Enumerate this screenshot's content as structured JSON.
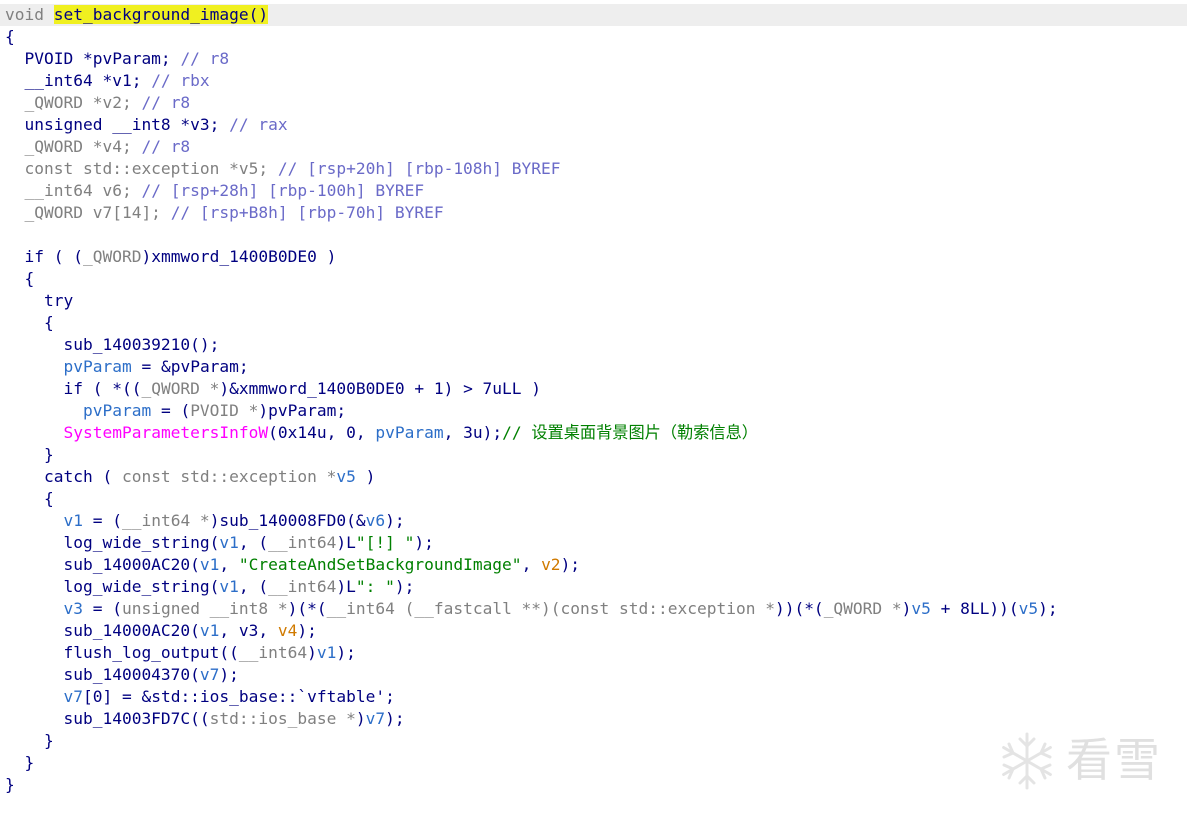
{
  "editor": {
    "theme": {
      "background": "#ffffff",
      "current_line": "#eeeeee",
      "highlight": "#f0f020",
      "keyword": "#000080",
      "local_var": "#2c6ec8",
      "comment": "#6a6ac8",
      "string": "#008000",
      "import_func": "#ff00ff",
      "gray_type": "#808080",
      "arg_var": "#d07a00"
    },
    "lines": [
      {
        "current": true,
        "tokens": [
          {
            "t": "void ",
            "c": "gray"
          },
          {
            "t": "set_background_image()",
            "c": "hl"
          }
        ]
      },
      {
        "tokens": [
          {
            "t": "{",
            "c": "kw"
          }
        ]
      },
      {
        "tokens": [
          {
            "t": "  PVOID *pvParam; ",
            "c": "kw"
          },
          {
            "t": "// r8",
            "c": "cm"
          }
        ]
      },
      {
        "tokens": [
          {
            "t": "  __int64 *v1; ",
            "c": "kw"
          },
          {
            "t": "// rbx",
            "c": "cm"
          }
        ]
      },
      {
        "tokens": [
          {
            "t": "  _QWORD ",
            "c": "gray"
          },
          {
            "t": "*v2; ",
            "c": "gray"
          },
          {
            "t": "// r8",
            "c": "cm"
          }
        ]
      },
      {
        "tokens": [
          {
            "t": "  unsigned __int8 *v3; ",
            "c": "kw"
          },
          {
            "t": "// rax",
            "c": "cm"
          }
        ]
      },
      {
        "tokens": [
          {
            "t": "  _QWORD *v4; ",
            "c": "gray"
          },
          {
            "t": "// r8",
            "c": "cm"
          }
        ]
      },
      {
        "tokens": [
          {
            "t": "  const std::exception *v5; ",
            "c": "gray"
          },
          {
            "t": "// [rsp+20h] [rbp-108h] BYREF",
            "c": "cm"
          }
        ]
      },
      {
        "tokens": [
          {
            "t": "  __int64 v6; ",
            "c": "gray"
          },
          {
            "t": "// [rsp+28h] [rbp-100h] BYREF",
            "c": "cm"
          }
        ]
      },
      {
        "tokens": [
          {
            "t": "  _QWORD v7[14]; ",
            "c": "gray"
          },
          {
            "t": "// [rsp+B8h] [rbp-70h] BYREF",
            "c": "cm"
          }
        ]
      },
      {
        "tokens": [
          {
            "t": "",
            "c": "kw"
          }
        ]
      },
      {
        "tokens": [
          {
            "t": "  if ( (",
            "c": "kw"
          },
          {
            "t": "_QWORD",
            "c": "gray"
          },
          {
            "t": ")xmmword_1400B0DE0 )",
            "c": "kw"
          }
        ]
      },
      {
        "tokens": [
          {
            "t": "  {",
            "c": "kw"
          }
        ]
      },
      {
        "tokens": [
          {
            "t": "    try",
            "c": "kw"
          }
        ]
      },
      {
        "tokens": [
          {
            "t": "    {",
            "c": "kw"
          }
        ]
      },
      {
        "tokens": [
          {
            "t": "      sub_140039210();",
            "c": "kw"
          }
        ]
      },
      {
        "tokens": [
          {
            "t": "      ",
            "c": "kw"
          },
          {
            "t": "pvParam",
            "c": "lv"
          },
          {
            "t": " = &pvParam;",
            "c": "kw"
          }
        ]
      },
      {
        "tokens": [
          {
            "t": "      if ( *((",
            "c": "kw"
          },
          {
            "t": "_QWORD *",
            "c": "gray"
          },
          {
            "t": ")&xmmword_1400B0DE0 + 1) > 7uLL )",
            "c": "kw"
          }
        ]
      },
      {
        "tokens": [
          {
            "t": "        ",
            "c": "kw"
          },
          {
            "t": "pvParam",
            "c": "lv"
          },
          {
            "t": " = (",
            "c": "kw"
          },
          {
            "t": "PVOID *",
            "c": "gray"
          },
          {
            "t": ")pvParam;",
            "c": "kw"
          }
        ]
      },
      {
        "tokens": [
          {
            "t": "      ",
            "c": "kw"
          },
          {
            "t": "SystemParametersInfoW",
            "c": "imp"
          },
          {
            "t": "(0x14u, 0, ",
            "c": "kw"
          },
          {
            "t": "pvParam",
            "c": "lv"
          },
          {
            "t": ", 3u);",
            "c": "kw"
          },
          {
            "t": "// 设置桌面背景图片（勒索信息）",
            "c": "str"
          }
        ]
      },
      {
        "tokens": [
          {
            "t": "    }",
            "c": "kw"
          }
        ]
      },
      {
        "tokens": [
          {
            "t": "    catch ( ",
            "c": "kw"
          },
          {
            "t": "const std::exception *",
            "c": "gray"
          },
          {
            "t": "v5",
            "c": "lv"
          },
          {
            "t": " )",
            "c": "kw"
          }
        ]
      },
      {
        "tokens": [
          {
            "t": "    {",
            "c": "kw"
          }
        ]
      },
      {
        "tokens": [
          {
            "t": "      ",
            "c": "kw"
          },
          {
            "t": "v1",
            "c": "lv"
          },
          {
            "t": " = (",
            "c": "kw"
          },
          {
            "t": "__int64 *",
            "c": "gray"
          },
          {
            "t": ")sub_140008FD0(&",
            "c": "kw"
          },
          {
            "t": "v6",
            "c": "lv"
          },
          {
            "t": ");",
            "c": "kw"
          }
        ]
      },
      {
        "tokens": [
          {
            "t": "      log_wide_string(",
            "c": "kw"
          },
          {
            "t": "v1",
            "c": "lv"
          },
          {
            "t": ", (",
            "c": "kw"
          },
          {
            "t": "__int64",
            "c": "gray"
          },
          {
            "t": ")L",
            "c": "kw"
          },
          {
            "t": "\"[!] \"",
            "c": "str"
          },
          {
            "t": ");",
            "c": "kw"
          }
        ]
      },
      {
        "tokens": [
          {
            "t": "      sub_14000AC20(",
            "c": "kw"
          },
          {
            "t": "v1",
            "c": "lv"
          },
          {
            "t": ", ",
            "c": "kw"
          },
          {
            "t": "\"CreateAndSetBackgroundImage\"",
            "c": "str"
          },
          {
            "t": ", ",
            "c": "kw"
          },
          {
            "t": "v2",
            "c": "orange"
          },
          {
            "t": ");",
            "c": "kw"
          }
        ]
      },
      {
        "tokens": [
          {
            "t": "      log_wide_string(",
            "c": "kw"
          },
          {
            "t": "v1",
            "c": "lv"
          },
          {
            "t": ", (",
            "c": "kw"
          },
          {
            "t": "__int64",
            "c": "gray"
          },
          {
            "t": ")L",
            "c": "kw"
          },
          {
            "t": "\": \"",
            "c": "str"
          },
          {
            "t": ");",
            "c": "kw"
          }
        ]
      },
      {
        "tokens": [
          {
            "t": "      ",
            "c": "kw"
          },
          {
            "t": "v3",
            "c": "lv"
          },
          {
            "t": " = (",
            "c": "kw"
          },
          {
            "t": "unsigned __int8 *",
            "c": "gray"
          },
          {
            "t": ")(*(",
            "c": "kw"
          },
          {
            "t": "__int64 (__fastcall **)(const std::exception *",
            "c": "gray"
          },
          {
            "t": "))(*(",
            "c": "kw"
          },
          {
            "t": "_QWORD *",
            "c": "gray"
          },
          {
            "t": ")",
            "c": "kw"
          },
          {
            "t": "v5",
            "c": "lv"
          },
          {
            "t": " + 8LL))(",
            "c": "kw"
          },
          {
            "t": "v5",
            "c": "lv"
          },
          {
            "t": ");",
            "c": "kw"
          }
        ]
      },
      {
        "tokens": [
          {
            "t": "      sub_14000AC20(",
            "c": "kw"
          },
          {
            "t": "v1",
            "c": "lv"
          },
          {
            "t": ", v3, ",
            "c": "kw"
          },
          {
            "t": "v4",
            "c": "orange"
          },
          {
            "t": ");",
            "c": "kw"
          }
        ]
      },
      {
        "tokens": [
          {
            "t": "      flush_log_output((",
            "c": "kw"
          },
          {
            "t": "__int64",
            "c": "gray"
          },
          {
            "t": ")",
            "c": "kw"
          },
          {
            "t": "v1",
            "c": "lv"
          },
          {
            "t": ");",
            "c": "kw"
          }
        ]
      },
      {
        "tokens": [
          {
            "t": "      sub_140004370(",
            "c": "kw"
          },
          {
            "t": "v7",
            "c": "lv"
          },
          {
            "t": ");",
            "c": "kw"
          }
        ]
      },
      {
        "tokens": [
          {
            "t": "      ",
            "c": "kw"
          },
          {
            "t": "v7",
            "c": "lv"
          },
          {
            "t": "[0] = &std::ios_base::`vftable';",
            "c": "kw"
          }
        ]
      },
      {
        "tokens": [
          {
            "t": "      sub_14003FD7C((",
            "c": "kw"
          },
          {
            "t": "std::ios_base *",
            "c": "gray"
          },
          {
            "t": ")",
            "c": "kw"
          },
          {
            "t": "v7",
            "c": "lv"
          },
          {
            "t": ");",
            "c": "kw"
          }
        ]
      },
      {
        "tokens": [
          {
            "t": "    }",
            "c": "kw"
          }
        ]
      },
      {
        "tokens": [
          {
            "t": "  }",
            "c": "kw"
          }
        ]
      },
      {
        "tokens": [
          {
            "t": "}",
            "c": "kw"
          }
        ]
      }
    ]
  },
  "watermark": {
    "icon": "snowflake-icon",
    "text": "看雪"
  }
}
